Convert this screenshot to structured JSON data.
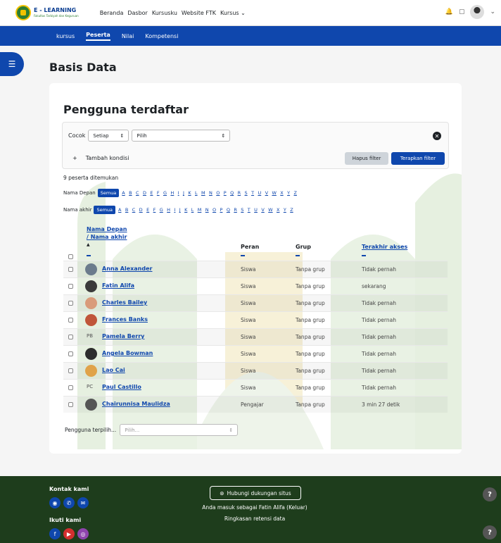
{
  "brand": {
    "title": "E - LEARNING",
    "subtitle": "Fakultas Tarbiyah dan Keguruan"
  },
  "nav": {
    "items": [
      "Beranda",
      "Dasbor",
      "Kursusku",
      "Website FTK",
      "Kursus ⌄"
    ]
  },
  "topright": {
    "bell": "🔔",
    "chat": "▢",
    "caret": "⌄"
  },
  "secnav": {
    "items": [
      "kursus",
      "Peserta",
      "Nilai",
      "Kompetensi"
    ],
    "active": "Peserta"
  },
  "page": {
    "title": "Basis Data"
  },
  "card": {
    "title": "Pengguna terdaftar"
  },
  "filter": {
    "match_label": "Cocok",
    "match_value": "Setiap",
    "select_value": "Pilih",
    "add_label": "Tambah kondisi",
    "clear_label": "Hapus filter",
    "apply_label": "Terapkan filter"
  },
  "count_text": "9 peserta ditemukan",
  "first_name_filter": {
    "label": "Nama Depan",
    "all": "Semua",
    "letters": [
      "A",
      "B",
      "C",
      "D",
      "E",
      "F",
      "G",
      "H",
      "I",
      "J",
      "K",
      "L",
      "M",
      "N",
      "O",
      "P",
      "Q",
      "R",
      "S",
      "T",
      "U",
      "V",
      "W",
      "X",
      "Y",
      "Z"
    ]
  },
  "last_name_filter": {
    "label": "Nama akhir",
    "all": "Semua",
    "letters": [
      "A",
      "B",
      "C",
      "D",
      "E",
      "F",
      "G",
      "H",
      "I",
      "J",
      "K",
      "L",
      "M",
      "N",
      "O",
      "P",
      "Q",
      "R",
      "S",
      "T",
      "U",
      "V",
      "W",
      "X",
      "Y",
      "Z"
    ]
  },
  "table": {
    "headers": {
      "first": "Nama Depan",
      "last": "/ Nama akhir",
      "sort_arrow": "▲",
      "role": "Peran",
      "group": "Grup",
      "last_access": "Terakhir akses"
    },
    "rows": [
      {
        "name": "Anna Alexander",
        "role": "Siswa",
        "group": "Tanpa grup",
        "access": "Tidak pernah",
        "initials": ""
      },
      {
        "name": "Fatin Alifa",
        "role": "Siswa",
        "group": "Tanpa grup",
        "access": "sekarang",
        "initials": ""
      },
      {
        "name": "Charles Bailey",
        "role": "Siswa",
        "group": "Tanpa grup",
        "access": "Tidak pernah",
        "initials": ""
      },
      {
        "name": "Frances Banks",
        "role": "Siswa",
        "group": "Tanpa grup",
        "access": "Tidak pernah",
        "initials": ""
      },
      {
        "name": "Pamela Berry",
        "role": "Siswa",
        "group": "Tanpa grup",
        "access": "Tidak pernah",
        "initials": "PB"
      },
      {
        "name": "Angela Bowman",
        "role": "Siswa",
        "group": "Tanpa grup",
        "access": "Tidak pernah",
        "initials": ""
      },
      {
        "name": "Lao Cai",
        "role": "Siswa",
        "group": "Tanpa grup",
        "access": "Tidak pernah",
        "initials": ""
      },
      {
        "name": "Paul Castillo",
        "role": "Siswa",
        "group": "Tanpa grup",
        "access": "Tidak pernah",
        "initials": "PC"
      },
      {
        "name": "Chairunnisa Maulidza",
        "role": "Pengajar",
        "group": "Tanpa grup",
        "access": "3 min 27 detik",
        "initials": ""
      }
    ]
  },
  "bulk": {
    "label": "Pengguna terpilih...",
    "placeholder": "Pilih..."
  },
  "footer": {
    "contact": "Kontak kami",
    "follow": "Ikuti kami",
    "support": "Hubungi dukungan situs",
    "logged_in": "Anda masuk sebagai Fatin Alifa (Keluar)",
    "retention": "Ringkasan retensi data",
    "help": "?"
  },
  "colors": {
    "primary": "#0f47ad",
    "footer": "#1e3d1c"
  }
}
